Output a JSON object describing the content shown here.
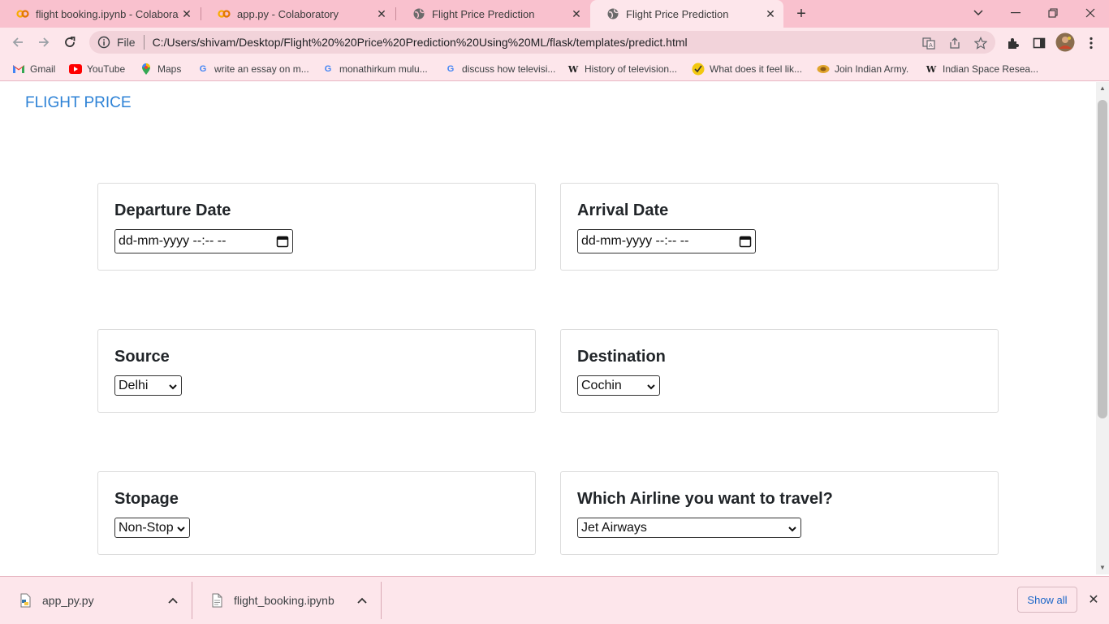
{
  "browser": {
    "tabs": [
      {
        "title": "flight booking.ipynb - Colaboratory",
        "icon": "colab-icon"
      },
      {
        "title": "app.py - Colaboratory",
        "icon": "colab-icon"
      },
      {
        "title": "Flight Price Prediction",
        "icon": "globe-icon"
      },
      {
        "title": "Flight Price Prediction",
        "icon": "globe-icon",
        "active": true
      }
    ],
    "address": {
      "scheme": "File",
      "url": "C:/Users/shivam/Desktop/Flight%20%20Price%20Prediction%20Using%20ML/flask/templates/predict.html"
    },
    "bookmarks": [
      {
        "label": "Gmail",
        "icon": "gmail-icon"
      },
      {
        "label": "YouTube",
        "icon": "youtube-icon"
      },
      {
        "label": "Maps",
        "icon": "maps-icon"
      },
      {
        "label": "write an essay on m...",
        "icon": "google-icon"
      },
      {
        "label": "monathirkum mulu...",
        "icon": "google-icon"
      },
      {
        "label": "discuss how televisi...",
        "icon": "google-icon"
      },
      {
        "label": "History of television...",
        "icon": "wikipedia-icon"
      },
      {
        "label": "What does it feel lik...",
        "icon": "site-icon"
      },
      {
        "label": "Join Indian Army.",
        "icon": "army-icon"
      },
      {
        "label": "Indian Space Resea...",
        "icon": "wikipedia-icon"
      }
    ]
  },
  "page": {
    "brand": "FLIGHT PRICE",
    "departure": {
      "label": "Departure Date",
      "placeholder": "dd-mm-yyyy --:-- --"
    },
    "arrival": {
      "label": "Arrival Date",
      "placeholder": "dd-mm-yyyy --:-- --"
    },
    "source": {
      "label": "Source",
      "value": "Delhi"
    },
    "destination": {
      "label": "Destination",
      "value": "Cochin"
    },
    "stopage": {
      "label": "Stopage",
      "value": "Non-Stop"
    },
    "airline": {
      "label": "Which Airline you want to travel?",
      "value": "Jet Airways"
    }
  },
  "downloads": {
    "items": [
      {
        "name": "app_py.py"
      },
      {
        "name": "flight_booking.ipynb"
      }
    ],
    "show_all": "Show all"
  },
  "colors": {
    "chrome_pink": "#f9c1ce",
    "toolbar_pink": "#fde6eb",
    "brand_blue": "#2d82d6"
  }
}
